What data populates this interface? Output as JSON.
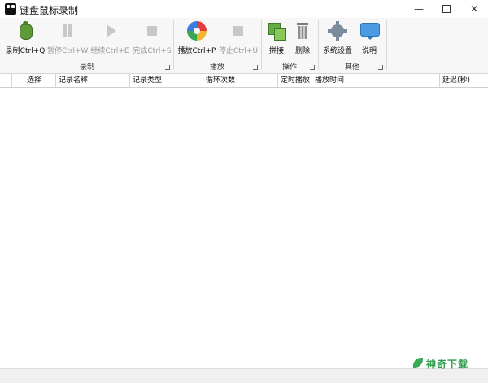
{
  "window": {
    "title": "键盘鼠标录制",
    "min_glyph": "—",
    "close_glyph": "✕"
  },
  "ribbon": {
    "groups": [
      {
        "label": "录制",
        "buttons": [
          {
            "label": "录制Ctrl+Q",
            "icon": "bug-record-icon",
            "enabled": true
          },
          {
            "label": "暂停Ctrl+W",
            "icon": "pause-icon",
            "enabled": false
          },
          {
            "label": "继续Ctrl+E",
            "icon": "play-icon",
            "enabled": false
          },
          {
            "label": "完成Ctrl+S",
            "icon": "stop-icon",
            "enabled": false
          }
        ]
      },
      {
        "label": "播放",
        "buttons": [
          {
            "label": "播放Ctrl+P",
            "icon": "disc-play-icon",
            "enabled": true
          },
          {
            "label": "停止Ctrl+U",
            "icon": "stop-icon",
            "enabled": false
          }
        ]
      },
      {
        "label": "操作",
        "buttons": [
          {
            "label": "拼接",
            "icon": "merge-icon",
            "enabled": true
          },
          {
            "label": "删除",
            "icon": "trash-icon",
            "enabled": true
          }
        ]
      },
      {
        "label": "其他",
        "buttons": [
          {
            "label": "系统设置",
            "icon": "gear-icon",
            "enabled": true
          },
          {
            "label": "说明",
            "icon": "help-bubble-icon",
            "enabled": true
          }
        ]
      }
    ]
  },
  "table": {
    "columns": [
      "选择",
      "记录名称",
      "记录类型",
      "循环次数",
      "定时播放",
      "播放时间",
      "延迟(秒)"
    ],
    "rows": []
  },
  "watermark": {
    "text": "神奇下载"
  }
}
